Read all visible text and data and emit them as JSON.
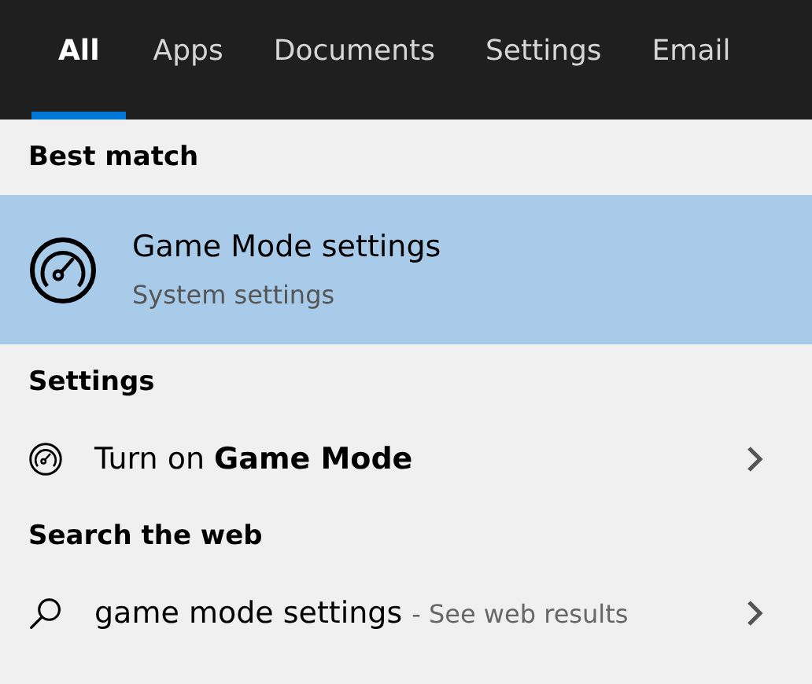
{
  "tabs": [
    {
      "label": "All",
      "selected": true
    },
    {
      "label": "Apps",
      "selected": false
    },
    {
      "label": "Documents",
      "selected": false
    },
    {
      "label": "Settings",
      "selected": false
    },
    {
      "label": "Email",
      "selected": false
    }
  ],
  "sections": [
    {
      "heading": "Best match",
      "items": [
        {
          "kind": "best",
          "title": "Game Mode settings",
          "subtitle": "System settings",
          "selected": true
        }
      ]
    },
    {
      "heading": "Settings",
      "items": [
        {
          "kind": "setting",
          "title": "Turn on **Game Mode**",
          "selected": false
        }
      ]
    },
    {
      "heading": "Search the web",
      "items": [
        {
          "kind": "web",
          "title": "game mode settings",
          "suffix": "- See web results",
          "selected": false
        }
      ]
    }
  ]
}
